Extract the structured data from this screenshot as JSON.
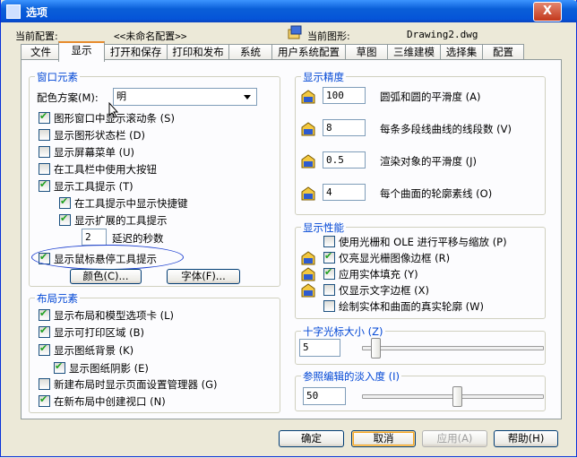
{
  "window": {
    "title": "选项",
    "close_label": "X"
  },
  "header": {
    "profile_label": "当前配置:",
    "profile_value": "<<未命名配置>>",
    "drawing_label": "当前图形:",
    "drawing_value": "Drawing2.dwg"
  },
  "tabs": [
    "文件",
    "显示",
    "打开和保存",
    "打印和发布",
    "系统",
    "用户系统配置",
    "草图",
    "三维建模",
    "选择集",
    "配置"
  ],
  "window_elements": {
    "title": "窗口元素",
    "scheme_label": "配色方案(M):",
    "scheme_value": "明",
    "items": [
      {
        "label": "图形窗口中显示滚动条 (S)",
        "checked": true
      },
      {
        "label": "显示图形状态栏 (D)",
        "checked": false
      },
      {
        "label": "显示屏幕菜单 (U)",
        "checked": false
      },
      {
        "label": "在工具栏中使用大按钮",
        "checked": false
      },
      {
        "label": "显示工具提示 (T)",
        "checked": true
      },
      {
        "label": "在工具提示中显示快捷键",
        "checked": true
      },
      {
        "label": "显示扩展的工具提示",
        "checked": true
      },
      {
        "label": "显示鼠标悬停工具提示",
        "checked": true
      }
    ],
    "delay_value": "2",
    "delay_label": "延迟的秒数",
    "colors_button": "颜色(C)...",
    "fonts_button": "字体(F)..."
  },
  "layout_elements": {
    "title": "布局元素",
    "items": [
      {
        "label": "显示布局和模型选项卡 (L)",
        "checked": true
      },
      {
        "label": "显示可打印区域 (B)",
        "checked": true
      },
      {
        "label": "显示图纸背景 (K)",
        "checked": true
      },
      {
        "label": "显示图纸阴影 (E)",
        "checked": true
      },
      {
        "label": "新建布局时显示页面设置管理器 (G)",
        "checked": false
      },
      {
        "label": "在新布局中创建视口 (N)",
        "checked": true
      }
    ]
  },
  "resolution": {
    "title": "显示精度",
    "items": [
      {
        "value": "100",
        "label": "圆弧和圆的平滑度 (A)"
      },
      {
        "value": "8",
        "label": "每条多段线曲线的线段数 (V)"
      },
      {
        "value": "0.5",
        "label": "渲染对象的平滑度 (J)"
      },
      {
        "value": "4",
        "label": "每个曲面的轮廓素线 (O)"
      }
    ]
  },
  "performance": {
    "title": "显示性能",
    "items": [
      {
        "label": "使用光栅和 OLE 进行平移与缩放 (P)",
        "checked": false
      },
      {
        "label": "仅亮显光栅图像边框 (R)",
        "checked": true
      },
      {
        "label": "应用实体填充 (Y)",
        "checked": true
      },
      {
        "label": "仅显示文字边框 (X)",
        "checked": false
      },
      {
        "label": "绘制实体和曲面的真实轮廓 (W)",
        "checked": false
      }
    ]
  },
  "crosshair": {
    "title": "十字光标大小 (Z)",
    "value": "5",
    "level": 5
  },
  "xref_fade": {
    "title": "参照编辑的淡入度 (I)",
    "value": "50",
    "level": 50
  },
  "footer": {
    "ok": "确定",
    "cancel": "取消",
    "apply": "应用(A)",
    "help": "帮助(H)"
  },
  "colors": {
    "group_title": "#0046d5",
    "title_bar": "#0554d8",
    "highlight_ellipse": "#1c3fd0"
  }
}
